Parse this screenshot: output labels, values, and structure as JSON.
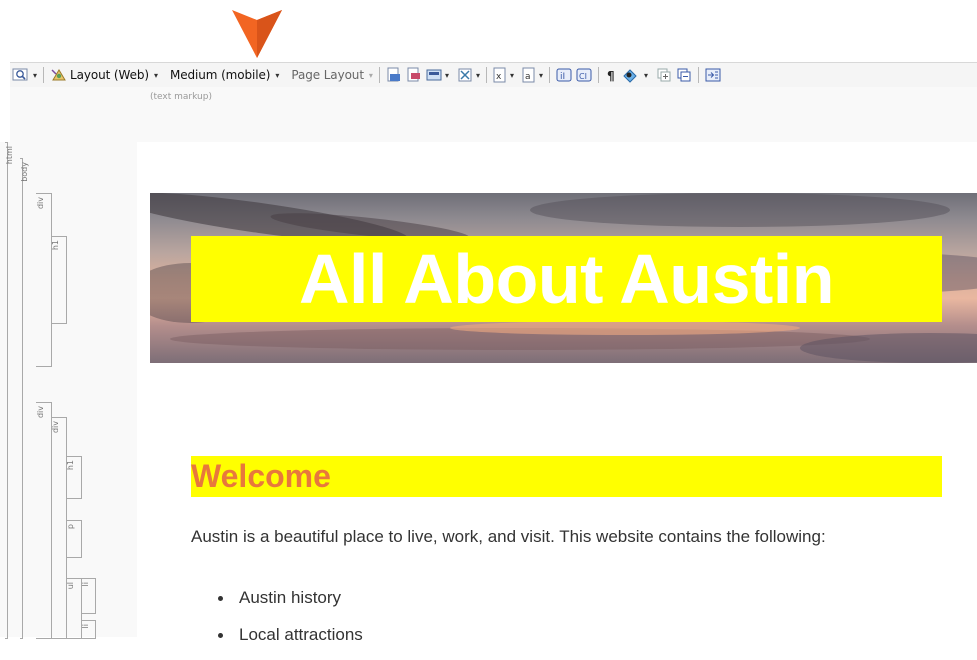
{
  "toolbar": {
    "layout_label": "Layout (Web)",
    "medium_label": "Medium (mobile)",
    "page_layout_label": "Page Layout",
    "caret": "▾"
  },
  "editor": {
    "markup_hint": "(text markup)"
  },
  "structure": {
    "html": "html",
    "body": "body",
    "div1": "div",
    "h1_1": "h1",
    "div2": "div",
    "div3": "div",
    "h1_2": "h1",
    "p": "p",
    "ul": "ul",
    "li1": "li",
    "li2": "li"
  },
  "page": {
    "banner_title": "All About Austin",
    "welcome_heading": "Welcome",
    "intro_text": "Austin is a beautiful place to live, work, and visit. This website contains the following:",
    "bullets": [
      "Austin history",
      "Local attractions"
    ]
  },
  "colors": {
    "callout": "#f26522",
    "highlight": "#ffff00",
    "heading": "#e8783c",
    "banner_text": "#ffffff"
  }
}
